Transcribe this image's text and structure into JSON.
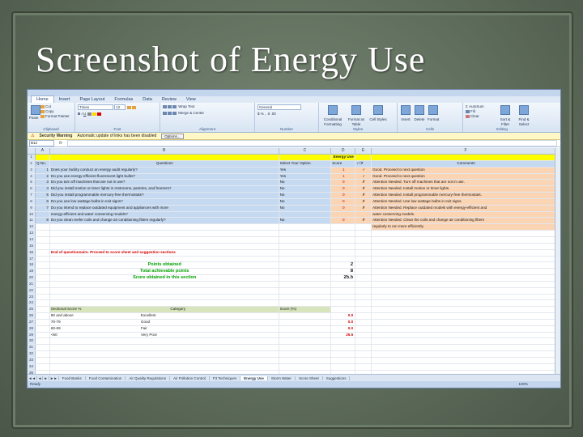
{
  "slide": {
    "title": "Screenshot of Energy Use"
  },
  "ribbon": {
    "tabs": [
      "Home",
      "Insert",
      "Page Layout",
      "Formulas",
      "Data",
      "Review",
      "View"
    ],
    "clipboard": {
      "paste": "Paste",
      "cut": "Cut",
      "copy": "Copy",
      "format_painter": "Format Painter",
      "label": "Clipboard"
    },
    "font": {
      "name": "Times",
      "size": "12",
      "label": "Font"
    },
    "alignment": {
      "wrap": "Wrap Text",
      "merge": "Merge & Center",
      "label": "Alignment"
    },
    "number": {
      "format": "General",
      "label": "Number"
    },
    "styles": {
      "conditional": "Conditional Formatting",
      "format_table": "Format as Table",
      "cell_styles": "Cell Styles",
      "label": "Styles"
    },
    "cells": {
      "insert": "Insert",
      "delete": "Delete",
      "format": "Format",
      "label": "Cells"
    },
    "editing": {
      "autosum": "AutoSum",
      "fill": "Fill",
      "clear": "Clear",
      "sort": "Sort & Filter",
      "find": "Find & Select",
      "label": "Editing"
    }
  },
  "security": {
    "title": "Security Warning",
    "message": "Automatic update of links has been disabled",
    "options": "Options..."
  },
  "formula_bar": {
    "name_box": "B12",
    "fx": "fx"
  },
  "columns": [
    "A",
    "B",
    "C",
    "D",
    "E",
    "F"
  ],
  "rows": [
    {
      "n": "1",
      "A": "",
      "B": "",
      "C": "",
      "D": "Energy Use",
      "E": "",
      "F": ""
    },
    {
      "n": "2",
      "A": "Q No.",
      "B": "Questions",
      "C": "Select Your Option",
      "D": "Score",
      "E": "✓/✗",
      "F": "Comments"
    },
    {
      "n": "3",
      "A": "1",
      "B": "Does your facility conduct an energy audit regularly?",
      "C": "Yes",
      "D": "1",
      "E": "✓",
      "F": "Good. Proceed to next question"
    },
    {
      "n": "4",
      "A": "2",
      "B": "Do you use energy-efficient fluorescent light bulbs?",
      "C": "Yes",
      "D": "1",
      "E": "✓",
      "F": "Good. Proceed to next question"
    },
    {
      "n": "5",
      "A": "3",
      "B": "Do you turn off machines that are not in use?",
      "C": "No",
      "D": "0",
      "E": "✗",
      "F": "Attention Needed. Turn off machines that are not in use."
    },
    {
      "n": "6",
      "A": "4",
      "B": "Did you install motion or timer lights in restrooms, pantries, and freezers?",
      "C": "No",
      "D": "0",
      "E": "✗",
      "F": "Attention Needed. Install motion or timer lights."
    },
    {
      "n": "7",
      "A": "5",
      "B": "Did you install programmable mercury-free thermostats?",
      "C": "No",
      "D": "0",
      "E": "✗",
      "F": "Attention Needed. Install programmable mercury-free thermostats."
    },
    {
      "n": "8",
      "A": "6",
      "B": "Do you use low wattage bulbs in exit signs?",
      "C": "No",
      "D": "0",
      "E": "✗",
      "F": "Attention Needed. Use low wattage bulbs in exit signs."
    },
    {
      "n": "9",
      "A": "7",
      "B": "Do you intend to replace outdated equipment and appliances with more",
      "C": "No",
      "D": "0",
      "E": "✗",
      "F": "Attention Needed. Replace outdated models with energy-efficient and"
    },
    {
      "n": "10",
      "A": "",
      "B": "energy-efficient and water conserving models?",
      "C": "",
      "D": "",
      "E": "",
      "F": "water conserving models."
    },
    {
      "n": "11",
      "A": "8",
      "B": "Do you clean reefer coils and change air conditioning filters regularly?",
      "C": "No",
      "D": "0",
      "E": "✗",
      "F": "Attention Needed. Clean the coils and change air conditioning filters"
    },
    {
      "n": "12",
      "A": "",
      "B": "",
      "C": "",
      "D": "",
      "E": "",
      "F": "regularly to run more efficiently."
    }
  ],
  "end_text": "End of questionnaire. Proceed to score sheet and suggestion sections",
  "summary": [
    {
      "n": "18",
      "label": "Points obtained",
      "value": "2"
    },
    {
      "n": "19",
      "label": "Total achievable points",
      "value": "8"
    },
    {
      "n": "20",
      "label": "Score obtained in this section",
      "value": "25.5"
    }
  ],
  "score_table": {
    "headers": {
      "score": "Sectional Score %",
      "category": "Category",
      "pct": "Score (%)"
    },
    "rows": [
      {
        "n": "26",
        "score": "80 and above",
        "category": "Excellent",
        "pct": "0.0"
      },
      {
        "n": "27",
        "score": "70-79",
        "category": "Good",
        "pct": "0.0"
      },
      {
        "n": "28",
        "score": "60-69",
        "category": "Fair",
        "pct": "0.0"
      },
      {
        "n": "29",
        "score": "<60",
        "category": "Very Poor",
        "pct": "25.5"
      }
    ]
  },
  "sheet_tabs": [
    "Food Banks",
    "Food Contamination",
    "Air Quality Regulations",
    "Air Pollution Control",
    "F3 Techniques",
    "Energy Use",
    "Storm Water",
    "Score Sheet",
    "Suggestions"
  ],
  "active_tab": "Energy Use",
  "status": {
    "ready": "Ready",
    "zoom": "100%"
  }
}
